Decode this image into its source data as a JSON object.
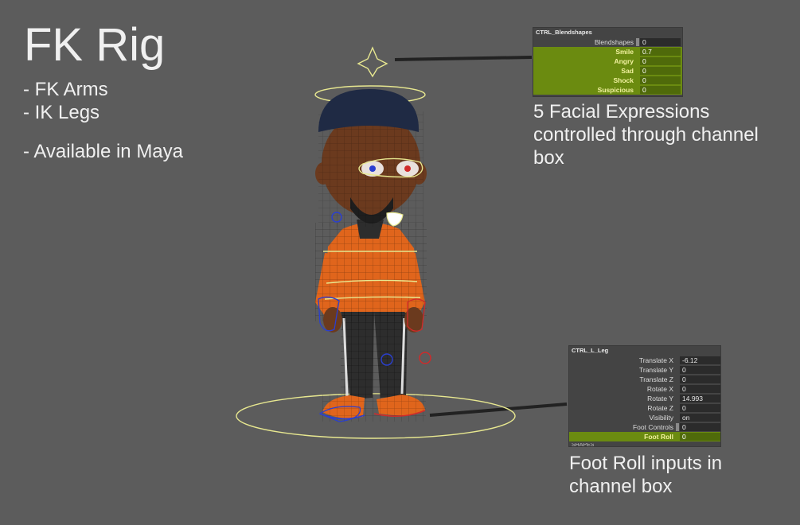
{
  "title": "FK Rig",
  "bullets": [
    "- FK Arms",
    "- IK Legs",
    "- Available in Maya"
  ],
  "captions": {
    "face": "5 Facial Expressions controlled through channel box",
    "foot": "Foot Roll inputs in channel box"
  },
  "blendshape_box": {
    "header": "CTRL_Blendshapes",
    "rows": [
      {
        "label": "Blendshapes",
        "value": "0",
        "highlight": false
      },
      {
        "label": "Smile",
        "value": "0.7",
        "highlight": true
      },
      {
        "label": "Angry",
        "value": "0",
        "highlight": true
      },
      {
        "label": "Sad",
        "value": "0",
        "highlight": true
      },
      {
        "label": "Shock",
        "value": "0",
        "highlight": true
      },
      {
        "label": "Suspicious",
        "value": "0",
        "highlight": true
      }
    ]
  },
  "leg_box": {
    "header": "CTRL_L_Leg",
    "rows": [
      {
        "label": "Translate X",
        "value": "-6.12",
        "highlight": false
      },
      {
        "label": "Translate Y",
        "value": "0",
        "highlight": false
      },
      {
        "label": "Translate Z",
        "value": "0",
        "highlight": false
      },
      {
        "label": "Rotate X",
        "value": "0",
        "highlight": false
      },
      {
        "label": "Rotate Y",
        "value": "14.993",
        "highlight": false
      },
      {
        "label": "Rotate Z",
        "value": "0",
        "highlight": false
      },
      {
        "label": "Visibility",
        "value": "on",
        "highlight": false
      },
      {
        "label": "Foot Controls",
        "value": "0",
        "highlight": false
      },
      {
        "label": "Foot Roll",
        "value": "0",
        "highlight": true
      }
    ],
    "footer": "SHAPES"
  },
  "colors": {
    "background": "#5c5c5c",
    "highlight_row": "#6b8b10",
    "curve_yellow": "#e8e890",
    "hoodie_orange": "#e0651c",
    "control_blue": "#2a3fd0",
    "control_red": "#d02a2a"
  }
}
